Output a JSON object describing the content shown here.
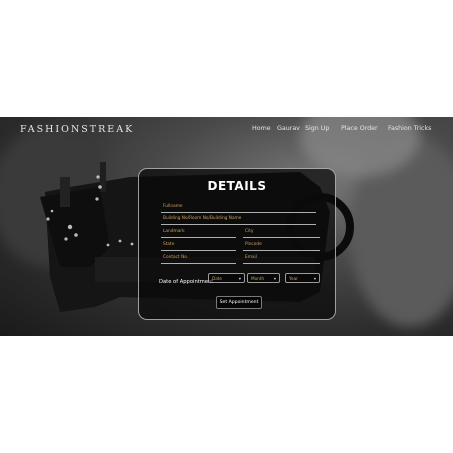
{
  "nav": {
    "brand": "FASHIONSTREAK",
    "links": [
      "Home",
      "Gaurav",
      "Sign Up",
      "Place Order",
      "Fashion Tricks"
    ]
  },
  "form": {
    "title": "DETAILS",
    "fields": {
      "fullname": "Fullname",
      "address": "Building No/Room No/Building Name",
      "landmark": "Landmark",
      "city": "City",
      "state": "State",
      "pincode": "Pincode",
      "contact": "Contact No.",
      "email": "Email"
    },
    "date_label": "Date of Appointment",
    "selects": {
      "day": "Date",
      "month": "Month",
      "year": "Year"
    },
    "submit_label": "Set Appointment"
  },
  "colors": {
    "placeholder": "#c9a15a",
    "panel_border": "#dcdcdc",
    "page_background": "#ffffff"
  }
}
